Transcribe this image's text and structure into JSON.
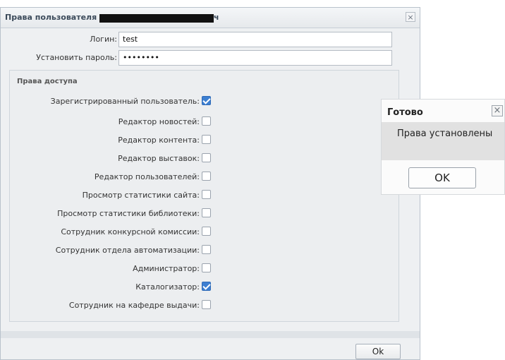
{
  "dialog": {
    "title": "Права пользователя",
    "title_suffix": "ч",
    "close_glyph": "×",
    "login_label": "Логин:",
    "login_value": "test",
    "password_label": "Установить пароль:",
    "password_value": "••••••••",
    "permissions_header": "Права доступа",
    "permissions": [
      {
        "label": "Зарегистрированный пользователь:",
        "checked": true
      },
      {
        "label": "Редактор новостей:",
        "checked": false
      },
      {
        "label": "Редактор контента:",
        "checked": false
      },
      {
        "label": "Редактор выставок:",
        "checked": false
      },
      {
        "label": "Редактор пользователей:",
        "checked": false
      },
      {
        "label": "Просмотр статистики сайта:",
        "checked": false
      },
      {
        "label": "Просмотр статистики библиотеки:",
        "checked": false
      },
      {
        "label": "Сотрудник конкурсной комиссии:",
        "checked": false
      },
      {
        "label": "Сотрудник отдела автоматизации:",
        "checked": false
      },
      {
        "label": "Администратор:",
        "checked": false
      },
      {
        "label": "Каталогизатор:",
        "checked": true
      },
      {
        "label": "Сотрудник на кафедре выдачи:",
        "checked": false
      }
    ],
    "ok_label": "Ok"
  },
  "popup": {
    "title": "Готово",
    "close_glyph": "×",
    "message": "Права установлены",
    "ok_label": "OK"
  },
  "colors": {
    "checkbox_checked": "#3d7fd1",
    "dialog_bg": "#eef0f2"
  }
}
